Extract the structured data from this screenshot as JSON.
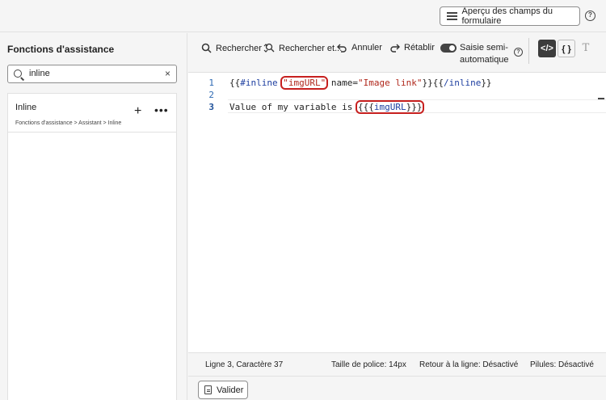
{
  "topbar": {
    "preview_label": "Aperçu des champs du formulaire",
    "help_glyph": "?"
  },
  "sidebar": {
    "title": "Fonctions d'assistance",
    "search": {
      "value": "inline",
      "clear_glyph": "×"
    },
    "items": [
      {
        "name": "Inline",
        "path": "Fonctions d'assistance > Assistant > Inline",
        "add_glyph": "+",
        "more_glyph": "•••"
      }
    ]
  },
  "toolbar": {
    "search_label": "Rechercher",
    "search_replace_label": "Rechercher et...",
    "undo_label": "Annuler",
    "redo_label": "Rétablir",
    "autocomplete_label": "Saisie semi-automatique",
    "autocomplete_on": true,
    "help_glyph": "?",
    "modes": [
      {
        "label": "</>",
        "active": true
      },
      {
        "label": "{ }",
        "active": false
      },
      {
        "label": "T",
        "active": false
      }
    ]
  },
  "editor": {
    "line_numbers": [
      "1",
      "2",
      "3"
    ],
    "active_line": 3,
    "lines": {
      "l1_open": "{{",
      "l1_kw": "#inline",
      "l1_sp": " ",
      "l1_str": "\"imgURL\"",
      "l1_attr": " name=",
      "l1_str2": "\"Image link\"",
      "l1_close": "}}{{",
      "l1_kw2": "/inline",
      "l1_end": "}}",
      "l2": "",
      "l3_text": "Value of my variable is ",
      "l3_open": "{{{",
      "l3_ident": "imgURL",
      "l3_close": "}}}"
    },
    "highlight_color": "#c7201f"
  },
  "status": {
    "position": "Ligne 3, Caractère 37",
    "font_size": "Taille de police: 14px",
    "wrap": "Retour à la ligne: Désactivé",
    "pills": "Pilules: Désactivé"
  },
  "footer": {
    "validate_label": "Valider"
  },
  "icons": [
    "list-icon",
    "help-icon",
    "search-icon",
    "clear-icon",
    "add-icon",
    "more-icon",
    "search-replace-icon",
    "undo-icon",
    "redo-icon",
    "toggle-icon",
    "code-icon",
    "json-icon",
    "text-icon",
    "validate-icon"
  ]
}
